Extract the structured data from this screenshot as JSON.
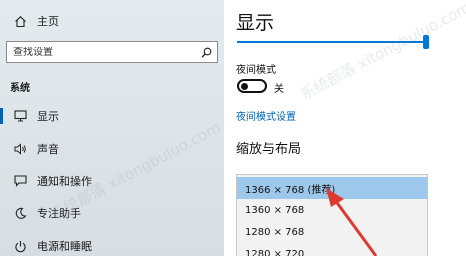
{
  "sidebar": {
    "home": {
      "label": "主页",
      "icon": "home-icon"
    },
    "search": {
      "placeholder": "查找设置",
      "icon": "search-icon"
    },
    "section_label": "系统",
    "items": [
      {
        "label": "显示",
        "icon": "monitor-icon",
        "active": true
      },
      {
        "label": "声音",
        "icon": "speaker-icon"
      },
      {
        "label": "通知和操作",
        "icon": "notification-icon"
      },
      {
        "label": "专注助手",
        "icon": "moon-icon"
      },
      {
        "label": "电源和睡眠",
        "icon": "power-icon"
      }
    ]
  },
  "main": {
    "title": "显示",
    "brightness_percent": 100,
    "night_light": {
      "label": "夜间模式",
      "state": "关",
      "link": "夜间模式设置"
    },
    "scale_section_title": "缩放与布局",
    "resolution_options": [
      {
        "label": "1366 × 768 (推荐)",
        "selected": true
      },
      {
        "label": "1360 × 768"
      },
      {
        "label": "1280 × 768"
      },
      {
        "label": "1280 × 720"
      }
    ]
  },
  "colors": {
    "accent": "#0078d7",
    "selection": "#9dc8ec",
    "arrow": "#e03a2f"
  },
  "watermark": "系统部落 xitongbuluo.com"
}
